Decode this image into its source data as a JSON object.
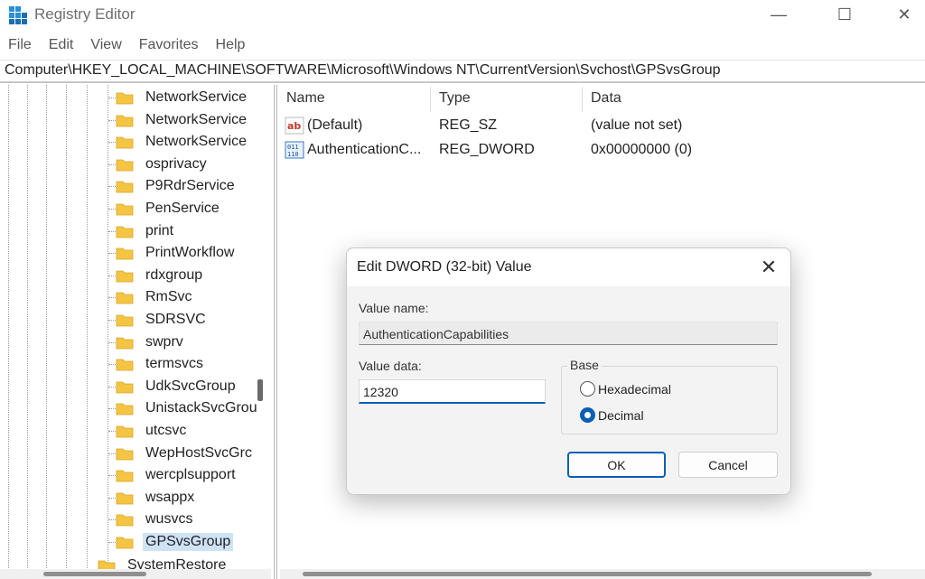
{
  "window": {
    "title": "Registry Editor",
    "controls": {
      "minimize": "—",
      "maximize": "☐",
      "close": "✕"
    }
  },
  "menu": [
    "File",
    "Edit",
    "View",
    "Favorites",
    "Help"
  ],
  "address": "Computer\\HKEY_LOCAL_MACHINE\\SOFTWARE\\Microsoft\\Windows NT\\CurrentVersion\\Svchost\\GPSvsGroup",
  "tree": {
    "items": [
      "NetworkService",
      "NetworkService",
      "NetworkService",
      "osprivacy",
      "P9RdrService",
      "PenService",
      "print",
      "PrintWorkflow",
      "rdxgroup",
      "RmSvc",
      "SDRSVC",
      "swprv",
      "termsvcs",
      "UdkSvcGroup",
      "UnistackSvcGrou",
      "utcsvc",
      "WepHostSvcGrc",
      "wercplsupport",
      "wsappx",
      "wusvcs",
      "GPSvsGroup"
    ],
    "selected": "GPSvsGroup",
    "partial_next": "SystemRestore"
  },
  "list": {
    "columns": {
      "name": "Name",
      "type": "Type",
      "data": "Data"
    },
    "rows": [
      {
        "icon": "string-value-icon",
        "name": "(Default)",
        "type": "REG_SZ",
        "data": "(value not set)"
      },
      {
        "icon": "binary-value-icon",
        "name": "AuthenticationC...",
        "type": "REG_DWORD",
        "data": "0x00000000 (0)"
      }
    ]
  },
  "dialog": {
    "title": "Edit DWORD (32-bit) Value",
    "value_name_label": "Value name:",
    "value_name": "AuthenticationCapabilities",
    "value_data_label": "Value data:",
    "value_data": "12320",
    "base_label": "Base",
    "base_options": [
      "Hexadecimal",
      "Decimal"
    ],
    "base_selected": "Decimal",
    "ok_label": "OK",
    "cancel_label": "Cancel",
    "close_glyph": "✕"
  },
  "colors": {
    "accent": "#0a5fb4",
    "folder": "#f4c542",
    "selection": "#cfe3f7"
  }
}
